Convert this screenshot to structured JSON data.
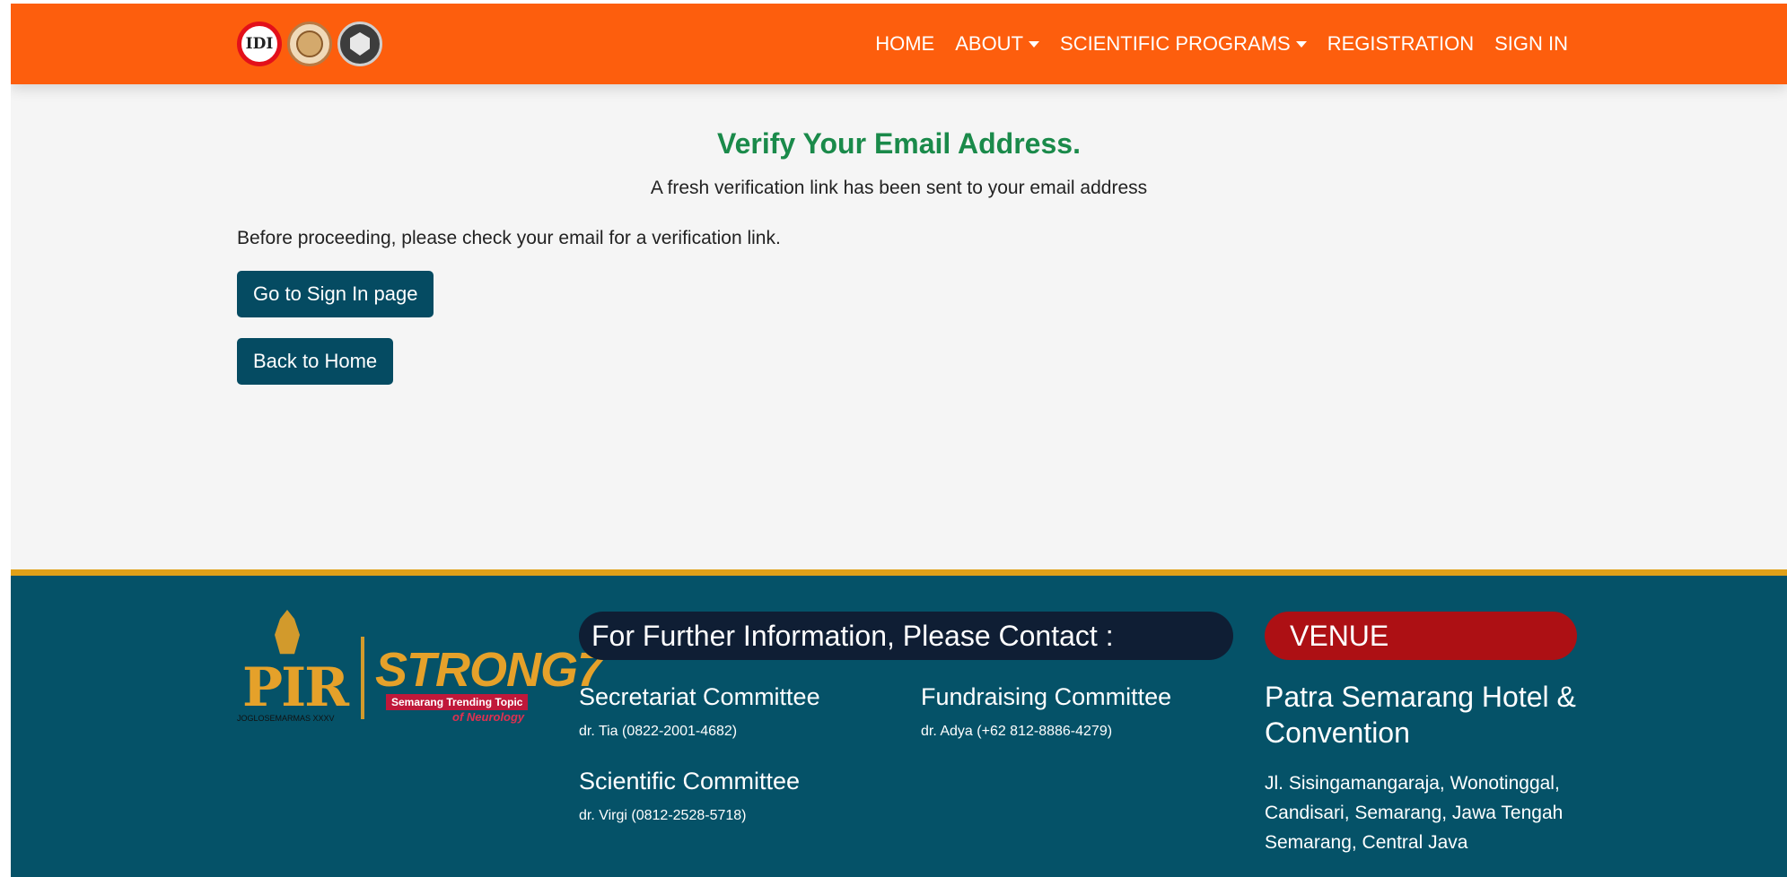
{
  "navbar": {
    "logos": [
      {
        "name": "idi-logo",
        "text": "IDI"
      },
      {
        "name": "perdossi-logo",
        "text": ""
      },
      {
        "name": "undip-logo",
        "text": ""
      }
    ],
    "items": [
      {
        "label": "HOME",
        "dropdown": false
      },
      {
        "label": "ABOUT",
        "dropdown": true
      },
      {
        "label": "SCIENTIFIC PROGRAMS",
        "dropdown": true
      },
      {
        "label": "REGISTRATION",
        "dropdown": false
      },
      {
        "label": "SIGN IN",
        "dropdown": false
      }
    ]
  },
  "main": {
    "title": "Verify Your Email Address.",
    "subtitle": "A fresh verification link has been sent to your email address",
    "instruction": "Before proceeding, please check your email for a verification link.",
    "signin_button": "Go to Sign In page",
    "home_button": "Back to Home"
  },
  "footer": {
    "logo": {
      "pir": "PIR",
      "pir_sub": "JOGLOSEMARMAS XXXV",
      "strong": "STRONG7",
      "strong_banner": "Semarang Trending Topic",
      "strong_neuro": "of Neurology"
    },
    "contact_heading": "For Further Information, Please Contact :",
    "committees": [
      {
        "title": "Secretariat Committee",
        "detail": "dr. Tia (0822-2001-4682)"
      },
      {
        "title": "Fundraising Committee",
        "detail": "dr. Adya (+62 812-8886-4279)"
      },
      {
        "title": "Scientific Committee",
        "detail": "dr. Virgi (0812-2528-5718)"
      }
    ],
    "venue_heading": "VENUE",
    "venue_name": "Patra Semarang Hotel & Convention",
    "venue_address_lines": [
      "Jl.  Sisingamangaraja,  Wonotinggal,",
      "Candisari, Semarang, Jawa Tengah",
      "Semarang, Central Java"
    ]
  },
  "colors": {
    "navbar": "#fd5e0d",
    "title_green": "#1a8a4a",
    "button": "#054b62",
    "footer": "#055268",
    "footer_border": "#e0a018",
    "contact_pill": "#0f1e34",
    "venue_pill": "#ad1014"
  }
}
